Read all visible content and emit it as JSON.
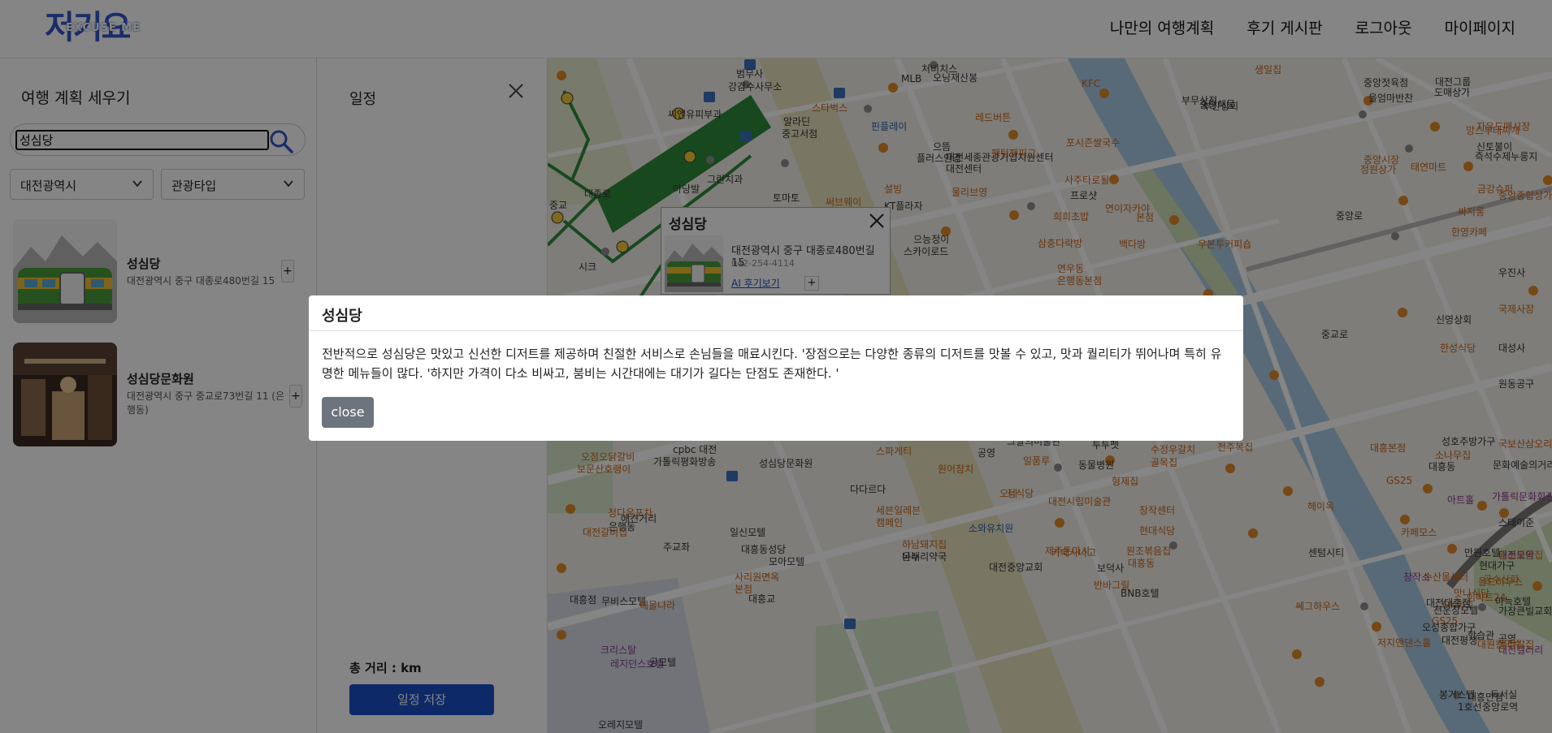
{
  "header": {
    "logo_text": "저기요",
    "logo_sub": "EXCUSE ME",
    "nav": [
      "나만의 여행계획",
      "후기 게시판",
      "로그아웃",
      "마이페이지"
    ]
  },
  "left_panel": {
    "title": "여행 계획 세우기",
    "search_value": "성심당",
    "region_select": "대전광역시",
    "type_select": "관광타입",
    "results": [
      {
        "name": "성심당",
        "address": "대전광역시 중구 대종로480번길 15",
        "add": "+"
      },
      {
        "name": "성심당문화원",
        "address": "대전광역시 중구 중교로73번길 11 (은행동)",
        "add": "+"
      }
    ]
  },
  "schedule": {
    "title": "일정",
    "distance": "총 거리 : km",
    "save_label": "일정 저장"
  },
  "info_window": {
    "title": "성심당",
    "address": "대전광역시 중구 대종로480번길 15",
    "tel": "042-254-4114",
    "link": "AI 후기보기",
    "plus": "+"
  },
  "map_labels": [
    {
      "text": "범무사",
      "cls": ""
    },
    {
      "text": "강감수사무소",
      "cls": ""
    },
    {
      "text": "씨앤유피부과",
      "cls": ""
    },
    {
      "text": "스타벅스",
      "cls": "orange"
    },
    {
      "text": "MLB",
      "cls": ""
    },
    {
      "text": "처비치스",
      "cls": ""
    },
    {
      "text": "KFC",
      "cls": "orange"
    },
    {
      "text": "대전세종관광기업지원센터",
      "cls": ""
    },
    {
      "text": "대전센터",
      "cls": ""
    },
    {
      "text": "부무상점",
      "cls": ""
    },
    {
      "text": "중앙해물",
      "cls": ""
    },
    {
      "text": "부산상회",
      "cls": ""
    },
    {
      "text": "생일집",
      "cls": "orange"
    },
    {
      "text": "중앙젓육점",
      "cls": ""
    },
    {
      "text": "을엄마반찬",
      "cls": ""
    },
    {
      "text": "대전그룹",
      "cls": ""
    },
    {
      "text": "도매상가",
      "cls": ""
    },
    {
      "text": "레드버튼",
      "cls": "orange"
    },
    {
      "text": "핀플레이",
      "cls": "blue"
    },
    {
      "text": "알라딘",
      "cls": ""
    },
    {
      "text": "중고서점",
      "cls": ""
    },
    {
      "text": "으뜸",
      "cls": ""
    },
    {
      "text": "플러스안경",
      "cls": ""
    },
    {
      "text": "팬텀팬피그",
      "cls": "orange"
    },
    {
      "text": "포시즌쌀국수",
      "cls": "orange"
    },
    {
      "text": "사주타로될",
      "cls": "orange"
    },
    {
      "text": "자유도매시장",
      "cls": "orange"
    },
    {
      "text": "망스부대찌개",
      "cls": "orange"
    },
    {
      "text": "신토불이",
      "cls": ""
    },
    {
      "text": "즉석수제누룽지",
      "cls": ""
    },
    {
      "text": "중앙시장",
      "cls": "orange"
    },
    {
      "text": "정원상가",
      "cls": "orange"
    },
    {
      "text": "태연마트",
      "cls": "orange"
    },
    {
      "text": "마당발",
      "cls": ""
    },
    {
      "text": "그린치과",
      "cls": ""
    },
    {
      "text": "토마토",
      "cls": ""
    },
    {
      "text": "설빙",
      "cls": "orange"
    },
    {
      "text": "울리브영",
      "cls": "orange"
    },
    {
      "text": "써브웨이",
      "cls": "orange"
    },
    {
      "text": "KT플라자",
      "cls": ""
    },
    {
      "text": "프로샷",
      "cls": ""
    },
    {
      "text": "희희초밥",
      "cls": "orange"
    },
    {
      "text": "연이자카야",
      "cls": "orange"
    },
    {
      "text": "본점",
      "cls": "orange"
    },
    {
      "text": "오닝재산봉",
      "cls": ""
    },
    {
      "text": "싸지롱",
      "cls": "orange"
    },
    {
      "text": "금강슈퍼",
      "cls": "orange"
    },
    {
      "text": "중앙종합상가",
      "cls": "orange"
    },
    {
      "text": "한영카페",
      "cls": "orange"
    },
    {
      "text": "시크",
      "cls": ""
    },
    {
      "text": "으능정이",
      "cls": ""
    },
    {
      "text": "스카이로드",
      "cls": ""
    },
    {
      "text": "삼충다락방",
      "cls": "orange"
    },
    {
      "text": "백다방",
      "cls": "orange"
    },
    {
      "text": "우본투커피숍",
      "cls": "orange"
    },
    {
      "text": "가지씨돈까스",
      "cls": "orange"
    },
    {
      "text": "연우동",
      "cls": "orange"
    },
    {
      "text": "은행동본점",
      "cls": "orange"
    },
    {
      "text": "우진사",
      "cls": ""
    },
    {
      "text": "국제사장",
      "cls": "orange"
    },
    {
      "text": "신영상회",
      "cls": ""
    },
    {
      "text": "한성식당",
      "cls": "orange"
    },
    {
      "text": "대성사",
      "cls": ""
    },
    {
      "text": "원동공구",
      "cls": ""
    },
    {
      "text": "W커피공방",
      "cls": "orange"
    },
    {
      "text": "cpbc 대전",
      "cls": ""
    },
    {
      "text": "가톨릭평화방송",
      "cls": ""
    },
    {
      "text": "성심당문화원",
      "cls": ""
    },
    {
      "text": "다다르다",
      "cls": ""
    },
    {
      "text": "스파게티",
      "cls": "orange"
    },
    {
      "text": "공영",
      "cls": ""
    },
    {
      "text": "그날의미술관",
      "cls": ""
    },
    {
      "text": "투투펫",
      "cls": ""
    },
    {
      "text": "동물병원",
      "cls": ""
    },
    {
      "text": "수정우갈치",
      "cls": "orange"
    },
    {
      "text": "골목집",
      "cls": "orange"
    },
    {
      "text": "전주복집",
      "cls": "orange"
    },
    {
      "text": "대흥본점",
      "cls": "orange"
    },
    {
      "text": "성호주방가구",
      "cls": ""
    },
    {
      "text": "소나무집",
      "cls": "orange"
    },
    {
      "text": "국보산삼오리",
      "cls": "orange"
    },
    {
      "text": "대흥동",
      "cls": ""
    },
    {
      "text": "문화예술의거리",
      "cls": ""
    },
    {
      "text": "오점오닭갈비",
      "cls": "orange"
    },
    {
      "text": "보문산호랭이",
      "cls": "orange"
    },
    {
      "text": "원어참치",
      "cls": "orange"
    },
    {
      "text": "일품루",
      "cls": "orange"
    },
    {
      "text": "형제집",
      "cls": "orange"
    },
    {
      "text": "GS25",
      "cls": "orange"
    },
    {
      "text": "가톨릭문화회관",
      "cls": "purple"
    },
    {
      "text": "아트홀",
      "cls": "purple"
    },
    {
      "text": "은행동",
      "cls": ""
    },
    {
      "text": "애견거리",
      "cls": ""
    },
    {
      "text": "정다운포차",
      "cls": "orange"
    },
    {
      "text": "세븐일레븐",
      "cls": "orange"
    },
    {
      "text": "캠페인",
      "cls": "orange"
    },
    {
      "text": "오네",
      "cls": "orange"
    },
    {
      "text": "정식당",
      "cls": "orange"
    },
    {
      "text": "대전시립미술관",
      "cls": "orange"
    },
    {
      "text": "창작센터",
      "cls": "orange"
    },
    {
      "text": "헤이옥",
      "cls": "orange"
    },
    {
      "text": "스테이준",
      "cls": ""
    },
    {
      "text": "카페모스",
      "cls": "orange"
    },
    {
      "text": "대전갈비집",
      "cls": "orange"
    },
    {
      "text": "일신모텔",
      "cls": ""
    },
    {
      "text": "주교좌",
      "cls": ""
    },
    {
      "text": "대흥동성당",
      "cls": ""
    },
    {
      "text": "소와유치원",
      "cls": "blue"
    },
    {
      "text": "카페사나고",
      "cls": "orange"
    },
    {
      "text": "현대식당",
      "cls": "orange"
    },
    {
      "text": "센텀시티",
      "cls": ""
    },
    {
      "text": "OK마트",
      "cls": "orange"
    },
    {
      "text": "만원호텔",
      "cls": ""
    },
    {
      "text": "대흥점",
      "cls": ""
    },
    {
      "text": "무비스모텔",
      "cls": ""
    },
    {
      "text": "해물나라",
      "cls": "orange"
    },
    {
      "text": "하남돼지집",
      "cls": "orange"
    },
    {
      "text": "나래",
      "cls": ""
    },
    {
      "text": "온누리약국",
      "cls": ""
    },
    {
      "text": "제주돈마시",
      "cls": "orange"
    },
    {
      "text": "원조볶음집",
      "cls": "orange"
    },
    {
      "text": "대흥동",
      "cls": "orange"
    },
    {
      "text": "원조볶음집",
      "cls": "orange"
    },
    {
      "text": "대전오악",
      "cls": "purple"
    },
    {
      "text": "창작소",
      "cls": "purple"
    },
    {
      "text": "현대가구",
      "cls": ""
    },
    {
      "text": "곰수산회",
      "cls": "orange"
    },
    {
      "text": "수산물센터",
      "cls": "orange"
    },
    {
      "text": "올드하우스",
      "cls": "orange"
    },
    {
      "text": "맛나식당",
      "cls": "orange"
    },
    {
      "text": "모아모텔",
      "cls": ""
    },
    {
      "text": "보덕사",
      "cls": ""
    },
    {
      "text": "대전중앙교회",
      "cls": ""
    },
    {
      "text": "사리원면옥",
      "cls": "orange"
    },
    {
      "text": "본점",
      "cls": "orange"
    },
    {
      "text": "이마트24",
      "cls": "orange"
    },
    {
      "text": "아늑호텔",
      "cls": ""
    },
    {
      "text": "대전대흥점",
      "cls": ""
    },
    {
      "text": "가장큰빌교회",
      "cls": ""
    },
    {
      "text": "반바그릴",
      "cls": "orange"
    },
    {
      "text": "BNB호텔",
      "cls": ""
    },
    {
      "text": "GS25",
      "cls": "orange"
    },
    {
      "text": "쎄그하우스",
      "cls": "orange"
    },
    {
      "text": "천운장모텔",
      "cls": ""
    },
    {
      "text": "오성종합가구",
      "cls": ""
    },
    {
      "text": "공영",
      "cls": ""
    },
    {
      "text": "대전평생",
      "cls": ""
    },
    {
      "text": "학습관",
      "cls": ""
    },
    {
      "text": "저지앤댄스홀",
      "cls": "orange"
    },
    {
      "text": "대전갤러리",
      "cls": "purple"
    },
    {
      "text": "대원칼국수",
      "cls": "orange"
    },
    {
      "text": "골망칼집",
      "cls": "orange"
    },
    {
      "text": "크리스탈",
      "cls": "purple"
    },
    {
      "text": "레지던스호텔",
      "cls": "purple"
    },
    {
      "text": "공모텔",
      "cls": ""
    },
    {
      "text": "오레지모텔",
      "cls": ""
    },
    {
      "text": "봉거스텔",
      "cls": ""
    },
    {
      "text": "대흥만점",
      "cls": ""
    },
    {
      "text": "독서실",
      "cls": ""
    },
    {
      "text": "1호선",
      "cls": ""
    },
    {
      "text": "중앙로역",
      "cls": ""
    },
    {
      "text": "중교",
      "cls": ""
    },
    {
      "text": "대종로",
      "cls": ""
    },
    {
      "text": "중교로",
      "cls": ""
    },
    {
      "text": "대흥교",
      "cls": ""
    },
    {
      "text": "중앙로",
      "cls": ""
    }
  ],
  "modal": {
    "title": "성심당",
    "body": "전반적으로 성심당은 맛있고 신선한 디저트를 제공하며 친절한 서비스로 손님들을 매료시킨다. '장점으로는 다양한 종류의 디저트를 맛볼 수 있고, 맛과 퀄리티가 뛰어나며 특히 유명한 메뉴들이 많다. '하지만 가격이 다소 비싸고, 붐비는 시간대에는 대기가 길다는 단점도 존재한다. '",
    "close_label": "close"
  }
}
